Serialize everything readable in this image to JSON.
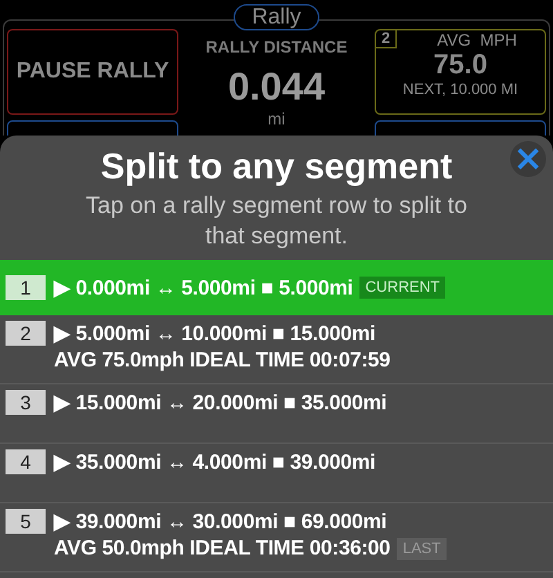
{
  "rally_screen": {
    "title": "Rally",
    "pause_button": "PAUSE RALLY",
    "distance_label": "RALLY DISTANCE",
    "distance_value": "0.044",
    "distance_unit": "mi",
    "next_box": {
      "number": "2",
      "label": "AVG  MPH",
      "value": "75.0",
      "next": "NEXT, 10.000 MI"
    },
    "current_box": {
      "kind": "panel"
    }
  },
  "sheet": {
    "title": "Split to any segment",
    "subtitle": "Tap on a rally segment row to split to that segment.",
    "close": "×",
    "segments": [
      {
        "number": "1",
        "line1": "▶ 0.000mi ↔ 5.000mi ■ 5.000mi",
        "tag": {
          "kind": "current",
          "text": "CURRENT"
        },
        "selected": true
      },
      {
        "number": "2",
        "line1": "▶ 5.000mi ↔ 10.000mi ■ 15.000mi",
        "line2": "AVG 75.0mph IDEAL TIME 00:07:59",
        "selected": false
      },
      {
        "number": "3",
        "line1": "▶ 15.000mi ↔ 20.000mi ■ 35.000mi",
        "selected": false
      },
      {
        "number": "4",
        "line1": "▶ 35.000mi ↔ 4.000mi ■ 39.000mi",
        "selected": false
      },
      {
        "number": "5",
        "line1": "▶ 39.000mi ↔ 30.000mi ■ 69.000mi",
        "line2": "AVG 50.0mph IDEAL TIME 00:36:00",
        "tag": {
          "kind": "last",
          "text": "LAST"
        },
        "selected": false
      }
    ]
  }
}
